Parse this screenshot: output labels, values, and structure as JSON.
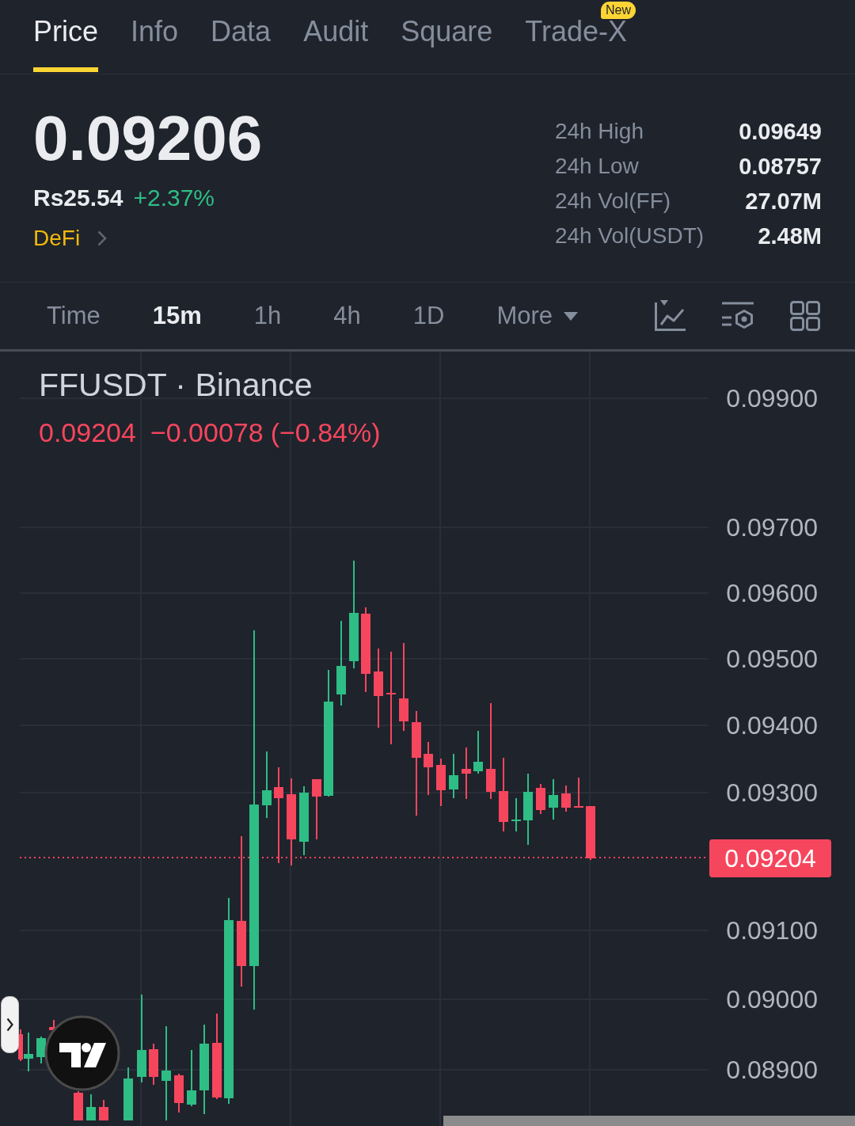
{
  "tabs": [
    {
      "label": "Price",
      "selected": true
    },
    {
      "label": "Info",
      "selected": false
    },
    {
      "label": "Data",
      "selected": false
    },
    {
      "label": "Audit",
      "selected": false
    },
    {
      "label": "Square",
      "selected": false
    },
    {
      "label": "Trade-X",
      "selected": false,
      "badge": "New"
    }
  ],
  "ticker": {
    "last_price": "0.09206",
    "fiat_price": "Rs25.54",
    "change": "+2.37%",
    "rising": true,
    "category": "DeFi"
  },
  "stats": [
    {
      "label": "24h High",
      "value": "0.09649"
    },
    {
      "label": "24h Low",
      "value": "0.08757"
    },
    {
      "label": "24h Vol(FF)",
      "value": "27.07M"
    },
    {
      "label": "24h Vol(USDT)",
      "value": "2.48M"
    }
  ],
  "intervals": [
    {
      "label": "Time",
      "selected": false
    },
    {
      "label": "15m",
      "selected": true
    },
    {
      "label": "1h",
      "selected": false
    },
    {
      "label": "4h",
      "selected": false
    },
    {
      "label": "1D",
      "selected": false
    }
  ],
  "more_menu": {
    "label": "More"
  },
  "chart": {
    "title": "FFUSDT · Binance",
    "last": "0.09204",
    "change": "−0.00078",
    "change_percent": "(−0.84%)",
    "rising": false,
    "price_axis": [
      "0.09900",
      "0.09700",
      "0.09600",
      "0.09500",
      "0.09400",
      "0.09300",
      "0.09100",
      "0.09000",
      "0.08900"
    ],
    "last_price_tag": "0.09204"
  }
}
